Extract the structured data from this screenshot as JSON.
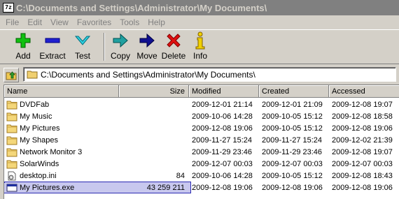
{
  "window": {
    "title": "C:\\Documents and Settings\\Administrator\\My Documents\\",
    "app_icon_text": "7z"
  },
  "menu": [
    "File",
    "Edit",
    "View",
    "Favorites",
    "Tools",
    "Help"
  ],
  "toolbar": {
    "add": "Add",
    "extract": "Extract",
    "test": "Test",
    "copy": "Copy",
    "move": "Move",
    "delete": "Delete",
    "info": "Info"
  },
  "address": {
    "path": "C:\\Documents and Settings\\Administrator\\My Documents\\"
  },
  "columns": {
    "name": "Name",
    "size": "Size",
    "modified": "Modified",
    "created": "Created",
    "accessed": "Accessed"
  },
  "files": [
    {
      "name": "DVDFab",
      "size": "",
      "modified": "2009-12-01 21:14",
      "created": "2009-12-01 21:09",
      "accessed": "2009-12-08 19:07",
      "type": "folder"
    },
    {
      "name": "My Music",
      "size": "",
      "modified": "2009-10-06 14:28",
      "created": "2009-10-05 15:12",
      "accessed": "2009-12-08 18:58",
      "type": "folder"
    },
    {
      "name": "My Pictures",
      "size": "",
      "modified": "2009-12-08 19:06",
      "created": "2009-10-05 15:12",
      "accessed": "2009-12-08 19:06",
      "type": "folder"
    },
    {
      "name": "My Shapes",
      "size": "",
      "modified": "2009-11-27 15:24",
      "created": "2009-11-27 15:24",
      "accessed": "2009-12-02 21:39",
      "type": "folder"
    },
    {
      "name": "Network Monitor 3",
      "size": "",
      "modified": "2009-11-29 23:46",
      "created": "2009-11-29 23:46",
      "accessed": "2009-12-08 19:07",
      "type": "folder"
    },
    {
      "name": "SolarWinds",
      "size": "",
      "modified": "2009-12-07 00:03",
      "created": "2009-12-07 00:03",
      "accessed": "2009-12-07 00:03",
      "type": "folder"
    },
    {
      "name": "desktop.ini",
      "size": "84",
      "modified": "2009-10-06 14:28",
      "created": "2009-10-05 15:12",
      "accessed": "2009-12-08 18:43",
      "type": "ini"
    },
    {
      "name": "My Pictures.exe",
      "size": "43 259 211",
      "modified": "2009-12-08 19:06",
      "created": "2009-12-08 19:06",
      "accessed": "2009-12-08 19:06",
      "type": "exe",
      "selected": true
    }
  ],
  "icons": {
    "up": "folder-up-icon",
    "folder": "folder-icon",
    "ini": "settings-file-icon",
    "exe": "application-icon"
  }
}
